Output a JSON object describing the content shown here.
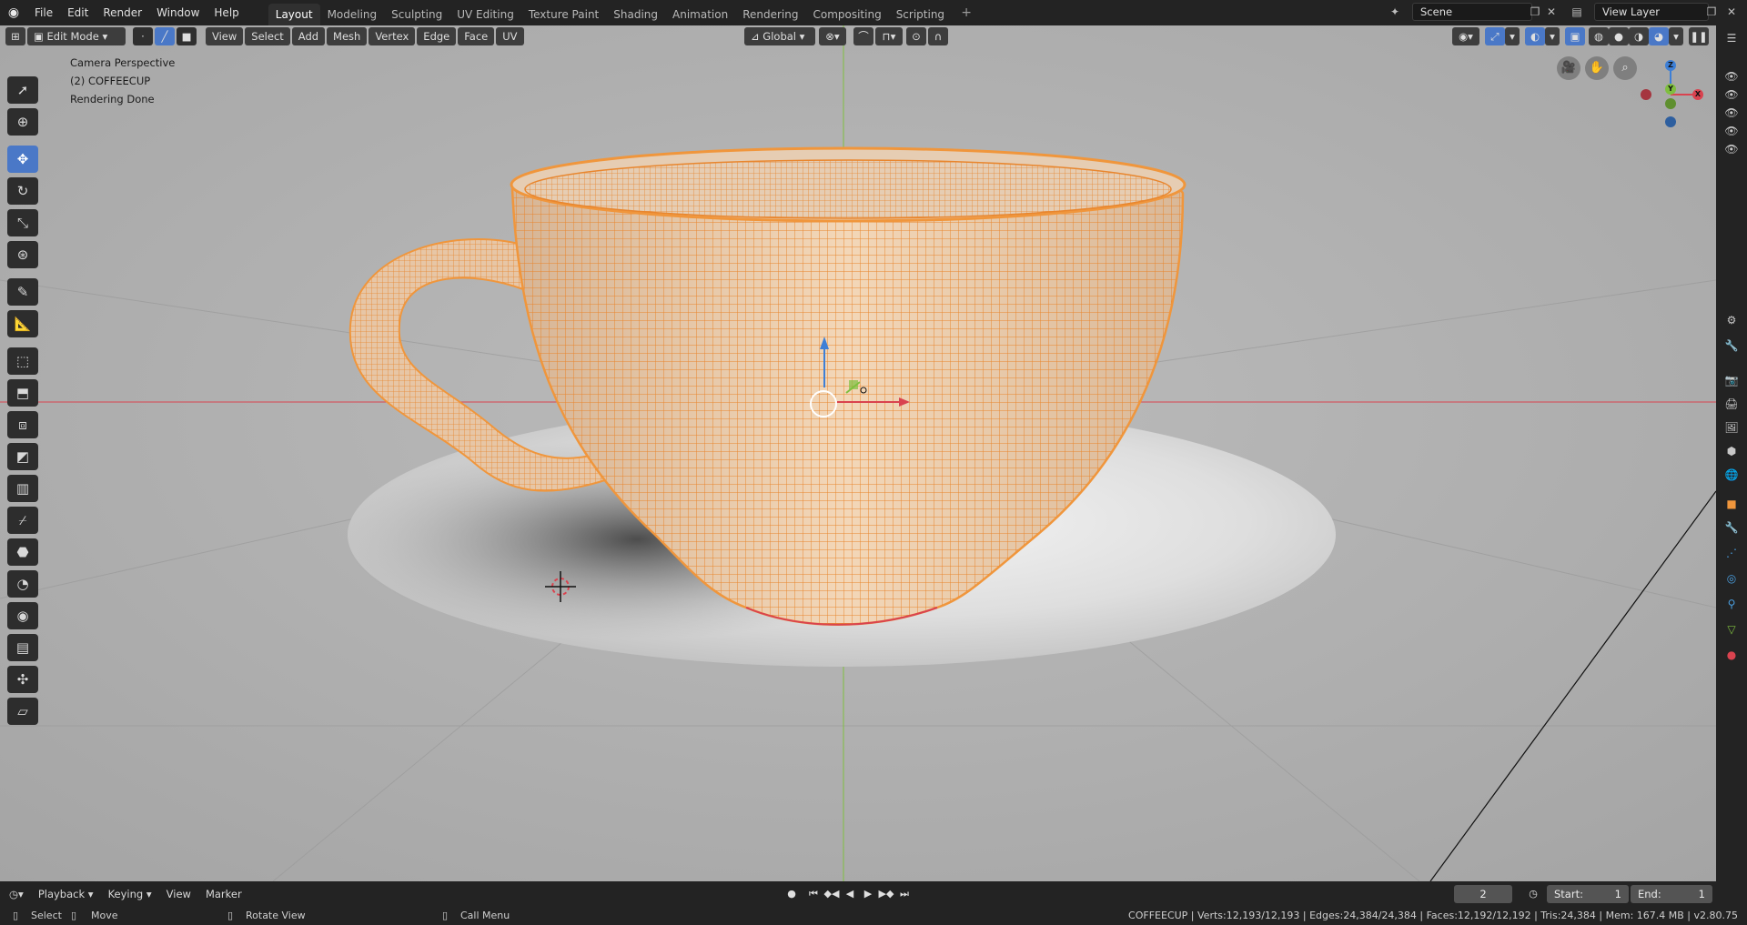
{
  "topbar": {
    "menus": [
      "File",
      "Edit",
      "Render",
      "Window",
      "Help"
    ],
    "workspaces": [
      "Layout",
      "Modeling",
      "Sculpting",
      "UV Editing",
      "Texture Paint",
      "Shading",
      "Animation",
      "Rendering",
      "Compositing",
      "Scripting"
    ],
    "active_workspace": "Layout",
    "scene_name": "Scene",
    "view_layer": "View Layer"
  },
  "viewport_header": {
    "mode": "Edit Mode",
    "menus": [
      "View",
      "Select",
      "Add",
      "Mesh",
      "Vertex",
      "Edge",
      "Face",
      "UV"
    ],
    "orientation": "Global"
  },
  "overlay": {
    "perspective": "Camera Perspective",
    "object": "(2) COFFEECUP",
    "status": "Rendering Done"
  },
  "timeline": {
    "menus": [
      "Playback",
      "Keying",
      "View",
      "Marker"
    ],
    "current_frame": "2",
    "start_label": "Start:",
    "start": "1",
    "end_label": "End:",
    "end": "1"
  },
  "statusbar": {
    "select": "Select",
    "move": "Move",
    "rotate": "Rotate View",
    "menu": "Call Menu",
    "stats": "COFFEECUP | Verts:12,193/12,193 | Edges:24,384/24,384 | Faces:12,192/12,192 | Tris:24,384 | Mem: 167.4 MB | v2.80.75"
  },
  "colors": {
    "accent": "#4a78c7",
    "wire": "#f0963c",
    "viewport_bg": "#b3b3b3",
    "x_axis": "#d9434f",
    "y_axis": "#7fbf3f",
    "z_axis": "#3d7fd6"
  },
  "icons": {
    "tools": [
      "cursor-select-icon",
      "3d-cursor-icon",
      "move-icon",
      "rotate-icon",
      "scale-icon",
      "transform-icon",
      "annotate-icon",
      "measure-icon",
      "add-cube-icon",
      "extrude-icon",
      "inset-icon",
      "bevel-icon",
      "loop-cut-icon",
      "knife-icon",
      "poly-build-icon",
      "spin-icon",
      "smooth-icon",
      "edge-slide-icon",
      "shrink-icon",
      "shear-icon",
      "rip-icon"
    ]
  }
}
